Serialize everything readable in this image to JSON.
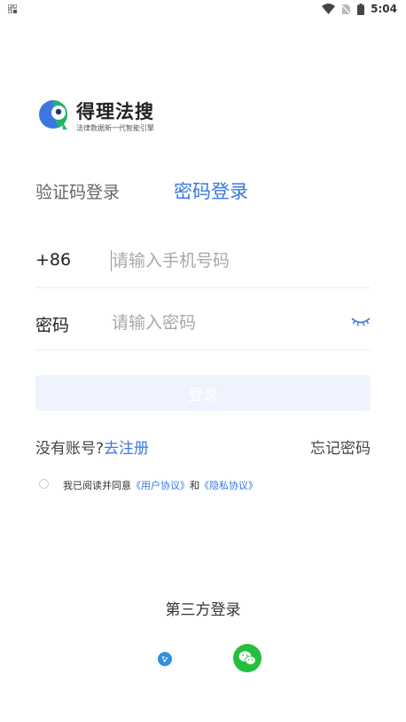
{
  "status_bar": {
    "time": "5:04",
    "icons": [
      "app-grid-icon",
      "wifi-icon",
      "no-sim-icon",
      "battery-icon"
    ]
  },
  "brand": {
    "title": "得理法搜",
    "subtitle": "法律数据新一代智能引擎"
  },
  "tabs": {
    "sms": "验证码登录",
    "password": "密码登录",
    "active": "password"
  },
  "phone_field": {
    "label": "+86",
    "placeholder": "请输入手机号码",
    "value": ""
  },
  "password_field": {
    "label": "密码",
    "placeholder": "请输入密码",
    "value": ""
  },
  "login_button": "登录",
  "no_account_prefix": "没有账号?",
  "register_link": "去注册",
  "forgot_password": "忘记密码",
  "agreement": {
    "prefix": "我已阅读并同意",
    "user_agreement": "《用户协议》",
    "and": "和",
    "privacy_agreement": "《隐私协议》"
  },
  "third_party": {
    "title": "第三方登录",
    "providers": [
      "blue-app-icon",
      "wechat-icon"
    ]
  },
  "colors": {
    "accent": "#3a78e0",
    "login_button_bg": "#eef3fd",
    "wechat_green": "#22c03c"
  }
}
